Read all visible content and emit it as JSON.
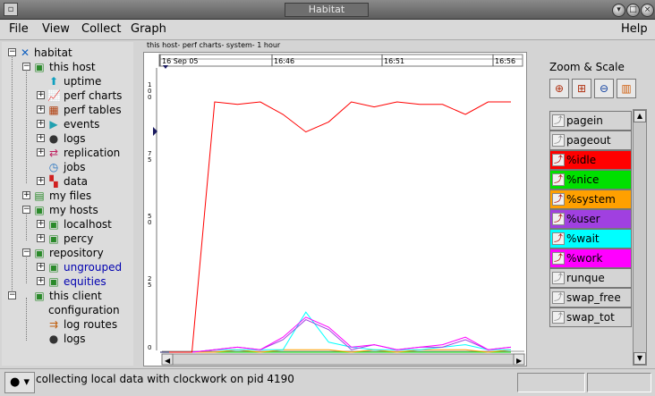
{
  "window": {
    "title": "Habitat"
  },
  "menu": {
    "file": "File",
    "view": "View",
    "collect": "Collect",
    "graph": "Graph",
    "help": "Help"
  },
  "tree": {
    "root": "habitat",
    "this_host": "this host",
    "uptime": "uptime",
    "perf_charts": "perf charts",
    "perf_tables": "perf tables",
    "events": "events",
    "logs": "logs",
    "replication": "replication",
    "jobs": "jobs",
    "data": "data",
    "my_files": "my files",
    "my_hosts": "my hosts",
    "localhost": "localhost",
    "percy": "percy",
    "repository": "repository",
    "ungrouped": "ungrouped",
    "equities": "equities",
    "this_client": "this client",
    "configuration": "configuration",
    "log_routes": "log routes",
    "client_logs": "logs"
  },
  "chart_caption": "this host- perf charts- system- 1 hour",
  "zoom_scale": {
    "title": "Zoom & Scale"
  },
  "legend": [
    {
      "label": "pagein",
      "color": "#d4d4d4",
      "active": false
    },
    {
      "label": "pageout",
      "color": "#d4d4d4",
      "active": false
    },
    {
      "label": "%idle",
      "color": "#ff0000",
      "active": true
    },
    {
      "label": "%nice",
      "color": "#00e000",
      "active": true
    },
    {
      "label": "%system",
      "color": "#ffa000",
      "active": true
    },
    {
      "label": "%user",
      "color": "#a040e0",
      "active": true
    },
    {
      "label": "%wait",
      "color": "#00ffff",
      "active": true
    },
    {
      "label": "%work",
      "color": "#ff00ff",
      "active": true
    },
    {
      "label": "runque",
      "color": "#d4d4d4",
      "active": false
    },
    {
      "label": "swap_free",
      "color": "#d4d4d4",
      "active": false
    },
    {
      "label": "swap_tot",
      "color": "#d4d4d4",
      "active": false
    }
  ],
  "status": {
    "text": "collecting local data with clockwork on pid 4190"
  },
  "chart_data": {
    "type": "line",
    "x_labels": [
      "16 Sep 05",
      "16:46",
      "16:51",
      "16:56"
    ],
    "y_labels": [
      "100",
      "75",
      "50",
      "25",
      "0"
    ],
    "ylim": [
      0,
      100
    ],
    "x": [
      0,
      1,
      2,
      3,
      4,
      5,
      6,
      7,
      8,
      9,
      10,
      11,
      12,
      13,
      14,
      15
    ],
    "series": [
      {
        "name": "%idle",
        "color": "#ff0000",
        "values": [
          0,
          0,
          100,
          99,
          100,
          95,
          88,
          92,
          100,
          98,
          100,
          99,
          99,
          95,
          100,
          100
        ]
      },
      {
        "name": "%work",
        "color": "#ff00ff",
        "values": [
          0,
          0,
          1,
          2,
          1,
          6,
          14,
          10,
          2,
          3,
          1,
          2,
          3,
          6,
          1,
          2
        ]
      },
      {
        "name": "%user",
        "color": "#a040e0",
        "values": [
          0,
          0,
          1,
          2,
          1,
          5,
          13,
          9,
          1,
          3,
          1,
          2,
          2,
          5,
          1,
          2
        ]
      },
      {
        "name": "%wait",
        "color": "#00ffff",
        "values": [
          0,
          0,
          1,
          1,
          1,
          1,
          16,
          4,
          2,
          1,
          1,
          1,
          2,
          3,
          1,
          1
        ]
      },
      {
        "name": "%system",
        "color": "#ffa000",
        "values": [
          0,
          0,
          0,
          1,
          0,
          1,
          1,
          1,
          0,
          1,
          0,
          1,
          1,
          1,
          0,
          1
        ]
      },
      {
        "name": "%nice",
        "color": "#00e000",
        "values": [
          0,
          0,
          0,
          0,
          0,
          0,
          0,
          0,
          0,
          0,
          0,
          0,
          0,
          0,
          0,
          0
        ]
      }
    ]
  }
}
